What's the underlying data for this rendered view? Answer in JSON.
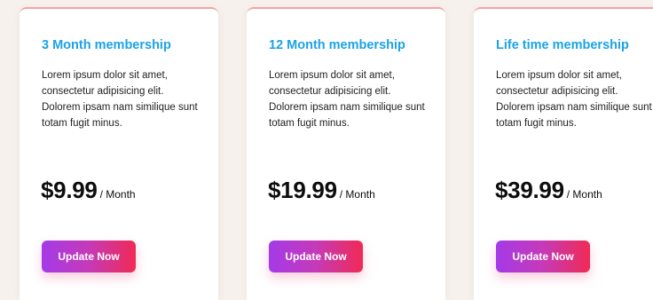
{
  "plans": [
    {
      "title": "3 Month membership",
      "description": "Lorem ipsum dolor sit amet, consectetur adipisicing elit. Dolorem ipsam nam similique sunt totam fugit minus.",
      "price": "$9.99",
      "period": "/ Month",
      "button_label": "Update Now"
    },
    {
      "title": "12 Month membership",
      "description": "Lorem ipsum dolor sit amet, consectetur adipisicing elit. Dolorem ipsam nam similique sunt totam fugit minus.",
      "price": "$19.99",
      "period": "/ Month",
      "button_label": "Update Now"
    },
    {
      "title": "Life time membership",
      "description": "Lorem ipsum dolor sit amet, consectetur adipisicing elit. Dolorem ipsam nam similique sunt totam fugit minus.",
      "price": "$39.99",
      "period": "/ Month",
      "button_label": "Update Now"
    }
  ],
  "colors": {
    "title": "#1aa3e8",
    "button_gradient_start": "#a43ae8",
    "button_gradient_end": "#f02a55",
    "card_border": "#f4a3a8",
    "background": "#f6f1ec"
  }
}
